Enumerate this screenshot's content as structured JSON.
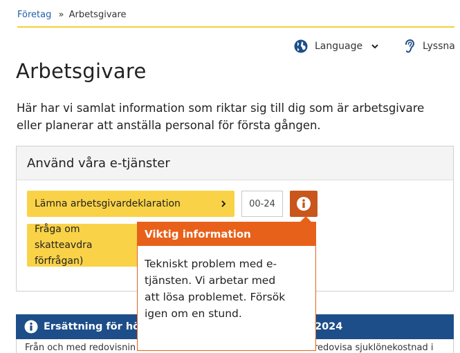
{
  "breadcrumb": {
    "parent": "Företag",
    "separator": "»",
    "current": "Arbetsgivare"
  },
  "header": {
    "language_label": "Language",
    "listen_label": "Lyssna"
  },
  "page": {
    "title": "Arbetsgivare",
    "intro": "Här har vi samlat information som riktar sig till dig som är arbetsgivare eller planerar att anställa personal för första gången."
  },
  "etjanster": {
    "heading": "Använd våra e-tjänster",
    "agd_button": "Lämna arbetsgivardeklaration",
    "time_value": "00-24",
    "skatt_button": "Fråga om skatteavdra förfrågan)"
  },
  "tooltip": {
    "title": "Viktig information",
    "body": "Tekniskt problem med e-tjänsten. Vi arbetar med att lösa problemet. Försök igen om en stund."
  },
  "notice": {
    "title_left": "Ersättning för höga",
    "title_right": "2024",
    "text_left": "Från och med redovisnin",
    "text_right": "redovisa sjuklönekostnad i"
  },
  "colors": {
    "accent_yellow": "#f9d247",
    "tooltip_orange": "#e8611a",
    "info_button": "#c9561b",
    "notice_blue": "#1d4e89",
    "link_blue": "#1f5fa8"
  },
  "icons": {
    "language": "globe-icon",
    "language_toggle": "chevron-down-icon",
    "listen": "ear-icon",
    "agd_button": "chevron-right-icon",
    "info_button": "info-icon",
    "notice": "info-circle-icon"
  }
}
